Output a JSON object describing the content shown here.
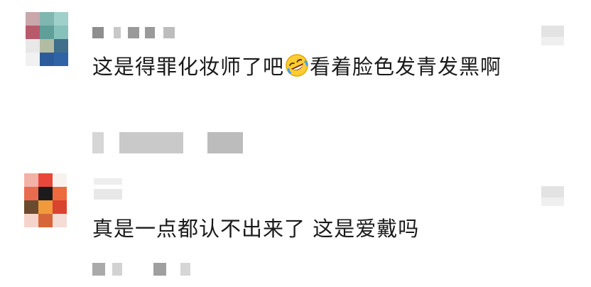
{
  "colors": {
    "text": "#1a1a1a",
    "mosaic_gray": "#b7b7b7",
    "background": "#ffffff"
  },
  "comments": [
    {
      "avatar_icon": "pixelated-avatar-icon",
      "text": "这是得罪化妆师了吧",
      "emoji": "rolling-on-floor-laughing-emoji",
      "text_after_emoji": "看着脸色发青发黑啊",
      "like_icon": "pixelated-like-icon"
    },
    {
      "avatar_icon": "pixelated-avatar-icon",
      "text": "真是一点都认不出来了 这是爱戴吗",
      "like_icon": "pixelated-like-icon"
    }
  ]
}
